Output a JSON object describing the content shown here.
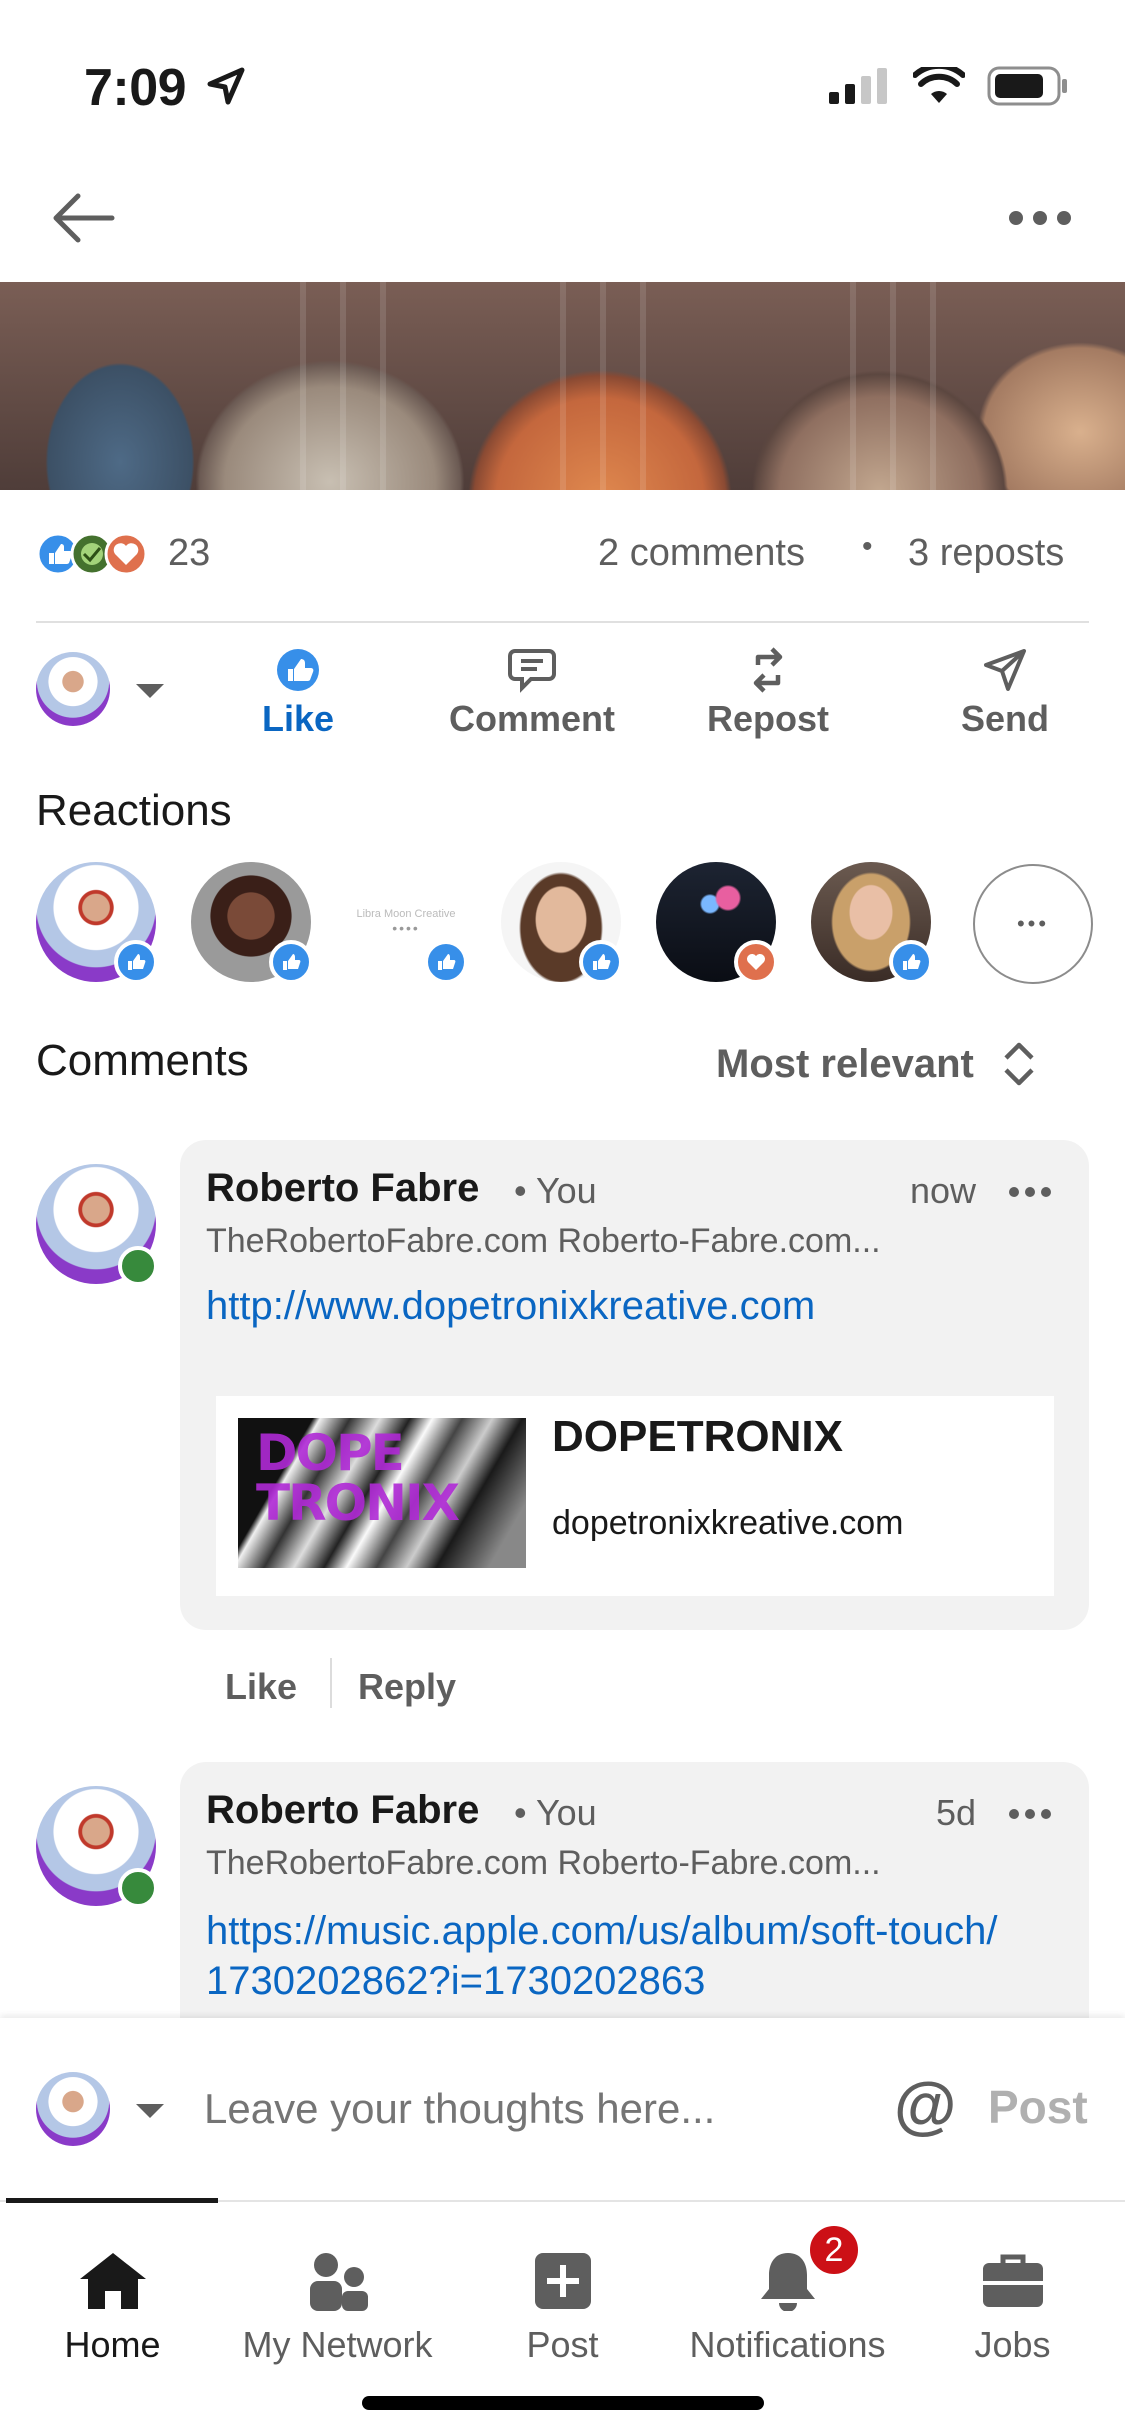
{
  "status": {
    "time": "7:09"
  },
  "post": {
    "reaction_count": "23",
    "comments_count": "2 comments",
    "separator": "•",
    "reposts_count": "3 reposts"
  },
  "actions": {
    "like": "Like",
    "comment": "Comment",
    "repost": "Repost",
    "send": "Send"
  },
  "reactions": {
    "title": "Reactions",
    "more": "•••",
    "brand_text": "Libra Moon Creative"
  },
  "comments_header": {
    "title": "Comments",
    "sort": "Most relevant"
  },
  "comments": [
    {
      "name": "Roberto Fabre",
      "you": "• You",
      "time": "now",
      "headline": "TheRobertoFabre.com Roberto-Fabre.com...",
      "link": "http://www.dopetronixkreative.com",
      "preview_title": "DOPETRONIX",
      "preview_domain": "dopetronixkreative.com",
      "preview_image_text": "DOPE TRONIX",
      "like": "Like",
      "reply": "Reply"
    },
    {
      "name": "Roberto Fabre",
      "you": "• You",
      "time": "5d",
      "headline": "TheRobertoFabre.com Roberto-Fabre.com...",
      "link": "https://music.apple.com/us/album/soft-touch/1730202862?i=1730202863"
    }
  ],
  "composer": {
    "placeholder": "Leave your thoughts here...",
    "mention": "@",
    "post": "Post"
  },
  "nav": {
    "home": "Home",
    "network": "My Network",
    "post": "Post",
    "notifications": "Notifications",
    "notifications_badge": "2",
    "jobs": "Jobs"
  },
  "colors": {
    "accent": "#0a66c2",
    "badge": "#cc1016",
    "online": "#378a3c"
  }
}
